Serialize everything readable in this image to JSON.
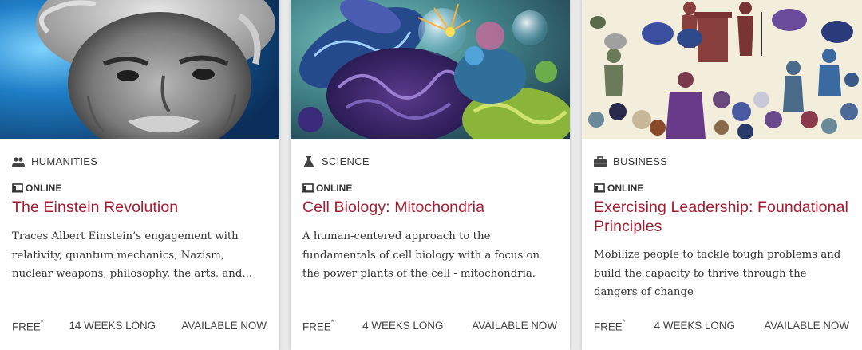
{
  "cards": [
    {
      "subject": "HUMANITIES",
      "subject_icon": "group-icon",
      "format": "ONLINE",
      "format_icon": "online-course-icon",
      "title": "The Einstein Revolution",
      "description": "Traces Albert Einstein’s engagement with relativity, quantum mechanics, Nazism, nuclear weapons, philosophy, the arts, and...",
      "price": "FREE",
      "price_note": "*",
      "duration": "14 WEEKS LONG",
      "availability": "AVAILABLE NOW"
    },
    {
      "subject": "SCIENCE",
      "subject_icon": "flask-icon",
      "format": "ONLINE",
      "format_icon": "online-course-icon",
      "title": "Cell Biology: Mitochondria",
      "description": "A human-centered approach to the fundamentals of cell biology with a focus on the power plants of the cell - mitochondria.",
      "price": "FREE",
      "price_note": "*",
      "duration": "4 WEEKS LONG",
      "availability": "AVAILABLE NOW"
    },
    {
      "subject": "BUSINESS",
      "subject_icon": "briefcase-icon",
      "format": "ONLINE",
      "format_icon": "online-course-icon",
      "title": "Exercising Leadership: Foundational Principles",
      "description": "Mobilize people to tackle tough problems and build the capacity to thrive through the dangers of change",
      "price": "FREE",
      "price_note": "*",
      "duration": "4 WEEKS LONG",
      "availability": "AVAILABLE NOW"
    }
  ],
  "colors": {
    "title": "#a51c30",
    "background": "#e9e9e9",
    "card": "#ffffff"
  }
}
